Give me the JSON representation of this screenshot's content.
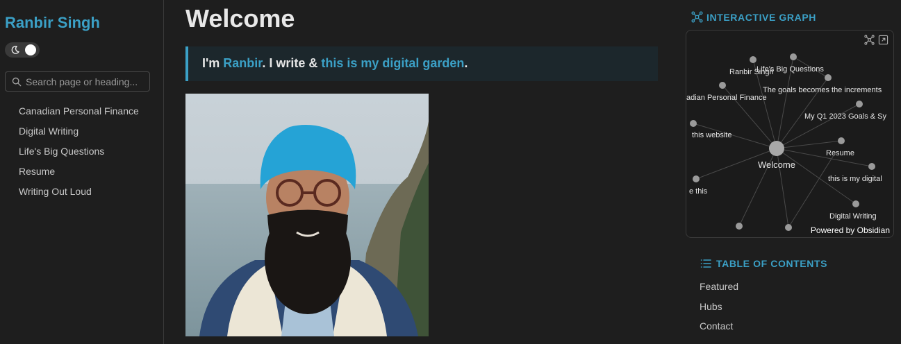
{
  "sidebar": {
    "site_title": "Ranbir Singh",
    "search_placeholder": "Search page or heading...",
    "nav": [
      "Canadian Personal Finance",
      "Digital Writing",
      "Life's Big Questions",
      "Resume",
      "Writing Out Loud"
    ]
  },
  "main": {
    "title": "Welcome",
    "callout": {
      "prefix": "I'm ",
      "name_link": "Ranbir",
      "middle": ". I write & ",
      "garden_link": "this is my digital garden",
      "suffix": "."
    }
  },
  "graph": {
    "label": "INTERACTIVE GRAPH",
    "powered_by": "Powered by Obsidian",
    "center_node": "Welcome",
    "nodes": [
      "Ranbir Singh",
      "Life's Big Questions",
      "The goals becomes the increments",
      "adian Personal Finance",
      "My Q1 2023 Goals & Sy",
      "this website",
      "Resume",
      "this is my digital",
      "e this",
      "Digital Writing"
    ]
  },
  "toc": {
    "label": "TABLE OF CONTENTS",
    "items": [
      "Featured",
      "Hubs",
      "Contact"
    ]
  },
  "colors": {
    "accent": "#3ba0c6",
    "background": "#1e1e1e",
    "callout_bg": "#1c272c"
  },
  "icons": [
    "moon-icon",
    "search-icon",
    "graph-icon",
    "global-graph-icon",
    "expand-icon",
    "list-icon"
  ]
}
